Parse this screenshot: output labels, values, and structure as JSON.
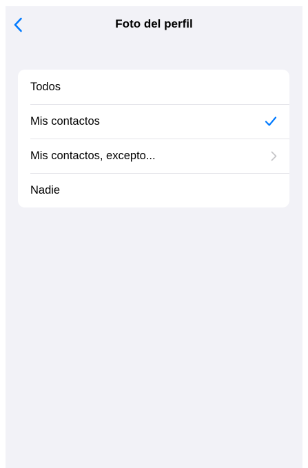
{
  "nav": {
    "title": "Foto del perfil",
    "back_icon": "chevron-left-icon"
  },
  "colors": {
    "accent": "#007aff",
    "background": "#f2f2f7",
    "card": "#ffffff",
    "separator": "#e3e3e8",
    "chevron": "#c4c4c7"
  },
  "options": [
    {
      "label": "Todos",
      "selected": false,
      "trailing_icon": ""
    },
    {
      "label": "Mis contactos",
      "selected": true,
      "trailing_icon": "checkmark-icon"
    },
    {
      "label": "Mis contactos, excepto...",
      "selected": false,
      "trailing_icon": "chevron-right-icon"
    },
    {
      "label": "Nadie",
      "selected": false,
      "trailing_icon": ""
    }
  ]
}
